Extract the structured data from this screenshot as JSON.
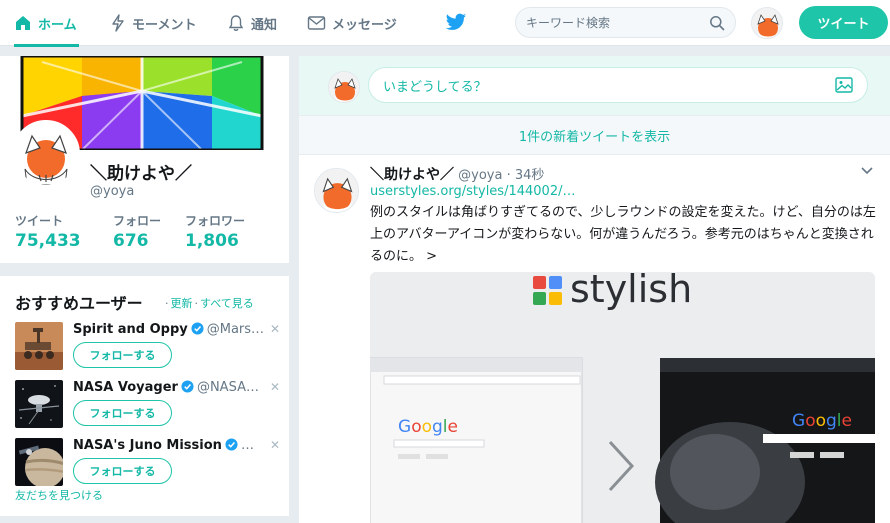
{
  "nav": {
    "home": "ホーム",
    "moments": "モーメント",
    "notifications": "通知",
    "messages": "メッセージ",
    "search_placeholder": "キーワード検索",
    "tweet_button": "ツイート",
    "accent_color": "#1ec5a8"
  },
  "profile": {
    "name": "＼助けよや／",
    "handle": "@yoya",
    "stats": [
      {
        "label": "ツイート",
        "value": "75,433"
      },
      {
        "label": "フォロー",
        "value": "676"
      },
      {
        "label": "フォロワー",
        "value": "1,806"
      }
    ]
  },
  "who_to_follow": {
    "title": "おすすめユーザー",
    "refresh": "更新",
    "view_all": "すべて見る",
    "users": [
      {
        "name": "Spirit and Oppy",
        "handle": "@Mars…",
        "follow": "フォローする"
      },
      {
        "name": "NASA Voyager",
        "handle": "@NASA…",
        "follow": "フォローする"
      },
      {
        "name": "NASA's Juno Mission",
        "handle": "…",
        "follow": "フォローする"
      }
    ],
    "find_friends": "友だちを見つける"
  },
  "composer": {
    "placeholder": "いまどうしてる？"
  },
  "new_tweets_bar": "1件の新着ツイートを表示",
  "tweet": {
    "name": "＼助けよや／",
    "handle": "@yoya",
    "time": "34秒",
    "link": "userstyles.org/styles/144002/…",
    "text": "例のスタイルは角ばりすぎてるので、少しラウンドの設定を変えた。けど、自分のは左上のアバターアイコンが変わらない。何が違うんだろう。参考元のはちゃんと変換されるのに。 >",
    "media_brand": "stylish"
  }
}
